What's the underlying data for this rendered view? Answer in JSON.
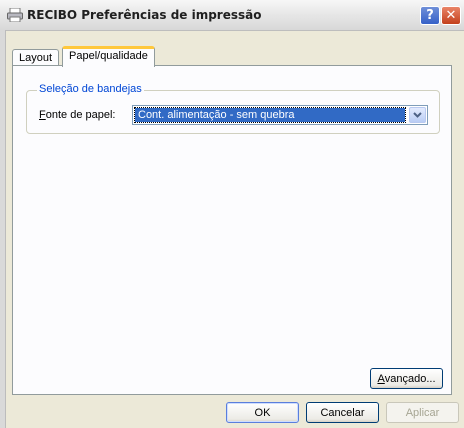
{
  "window": {
    "title": "RECIBO Preferências de impressão",
    "help_label": "?",
    "close_label": "✕"
  },
  "tabs": [
    {
      "label": "Layout",
      "selected": false
    },
    {
      "label": "Papel/qualidade",
      "selected": true
    }
  ],
  "paper_tray": {
    "group_title": "Seleção de bandejas",
    "source_label_mnemonic": "F",
    "source_label_rest": "onte de papel:",
    "source_value": "Cont. alimentação - sem quebra"
  },
  "buttons": {
    "advanced_mnemonic": "A",
    "advanced_rest": "vançado...",
    "ok": "OK",
    "cancel": "Cancelar",
    "apply": "Aplicar"
  },
  "colors": {
    "accent_tab": "#ffc83c",
    "selection": "#316ac5",
    "group_title": "#0046d5"
  }
}
